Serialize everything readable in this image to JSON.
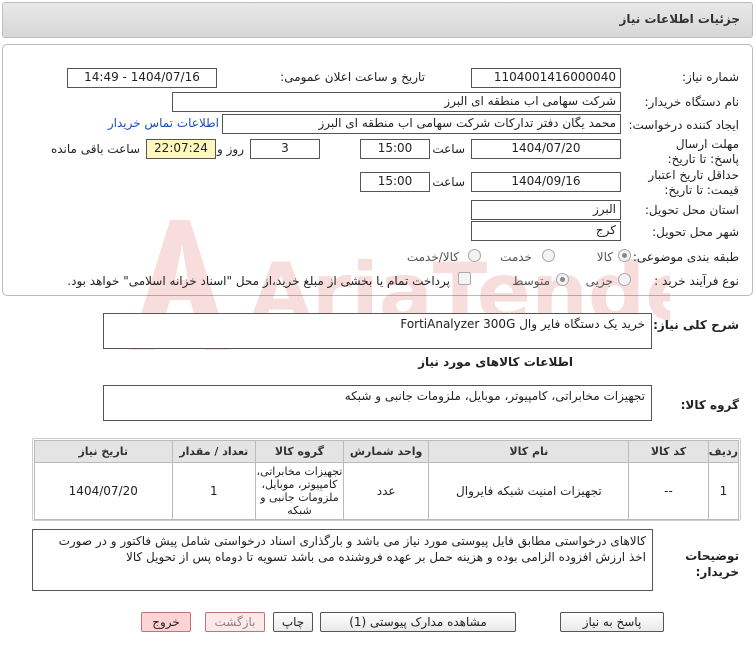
{
  "title": "جزئیات اطلاعات نیاز",
  "form": {
    "need_number_label": "شماره نیاز:",
    "need_number": "1104001416000040",
    "announce_label": "تاریخ و ساعت اعلان عمومی:",
    "announce_value": "1404/07/16 - 14:49",
    "buyer_org_label": "نام دستگاه خریدار:",
    "buyer_org": "شرکت سهامی اب منطقه ای البرز",
    "requester_label": "ایجاد کننده درخواست:",
    "requester": "محمد یگان دفتر تداركات شركت سهامی اب منطقه ای البرز",
    "contact_link": "اطلاعات تماس خریدار",
    "deadline_label": "مهلت ارسال پاسخ: تا تاریخ:",
    "deadline_date": "1404/07/20",
    "time_label": "ساعت",
    "deadline_time": "15:00",
    "days_value": "3",
    "days_label": "روز و",
    "remaining_time": "22:07:24",
    "remaining_label": "ساعت باقی مانده",
    "validity_label": "حداقل تاریخ اعتبار قیمت: تا تاریخ:",
    "validity_date": "1404/09/16",
    "validity_time": "15:00",
    "province_label": "استان محل تحویل:",
    "province": "البرز",
    "city_label": "شهر محل تحویل:",
    "city": "کرج",
    "category_label": "طبقه بندی موضوعی:",
    "category_options": [
      "کالا",
      "خدمت",
      "کالا/خدمت"
    ],
    "process_label": "نوع فرآیند خرید :",
    "process_options": [
      "جزیی",
      "متوسط"
    ],
    "payment_note": "پرداخت تمام یا بخشی از مبلغ خرید،از محل \"اسناد خزانه اسلامی\" خواهد بود."
  },
  "summary_label": "شرح کلی نیاز:",
  "summary": "خرید یک دستگاه فایر وال FortiAnalyzer 300G",
  "goods_section_title": "اطلاعات کالاهای مورد نیاز",
  "goods_group_label": "گروه کالا:",
  "goods_group": "تجهیزات مخابراتی، کامپیوتر، موبایل، ملزومات جانبی و شبکه",
  "table": {
    "headers": [
      "ردیف",
      "کد کالا",
      "نام کالا",
      "واحد شمارش",
      "گروه کالا",
      "تعداد / مقدار",
      "تاریخ نیاز"
    ],
    "rows": [
      {
        "row": "1",
        "code": "--",
        "name": "تجهیزات امنیت شبکه فایروال",
        "unit": "عدد",
        "group_lines": [
          "تجهیزات مخابراتی،",
          "کامپیوتر، موبایل،",
          "ملزومات جانبی و",
          "شبکه"
        ],
        "qty": "1",
        "date": "1404/07/20"
      }
    ]
  },
  "buyer_notes_label": "توضیحات خریدار:",
  "buyer_notes": "کالاهای درخواستی مطابق فایل پیوستی مورد نیاز می باشد و بارگذاری اسناد درخواستی شامل پیش فاکتور و در صورت اخذ ارزش افزوده الزامی بوده و هزینه حمل بر عهده فروشنده می باشد تسویه تا دوماه پس از تحویل کالا",
  "buttons": {
    "reply": "پاسخ به نیاز",
    "attachments": "مشاهده مدارک پیوستی (1)",
    "print": "چاپ",
    "back": "بازگشت",
    "exit": "خروج"
  },
  "watermark_text": "AriaTender.net"
}
